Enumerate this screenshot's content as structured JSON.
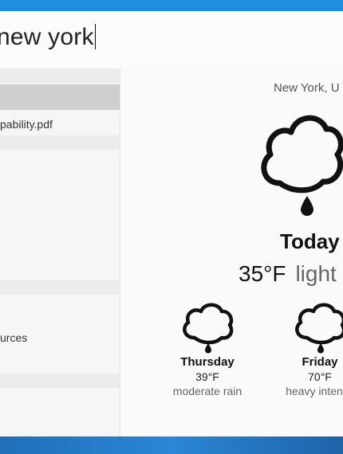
{
  "search": {
    "query": "new york"
  },
  "sidebar": {
    "file_item": "pability.pdf",
    "resources_item": "urces"
  },
  "weather": {
    "location": "New York, U",
    "today_label": "Today",
    "today_temp": "35°F",
    "today_condition": "light",
    "forecast": [
      {
        "day": "Thursday",
        "temp": "39°F",
        "condition": "moderate rain",
        "icon": "rain-cloud-icon"
      },
      {
        "day": "Friday",
        "temp": "70°F",
        "condition": "heavy intensit",
        "icon": "rain-cloud-icon"
      }
    ]
  }
}
